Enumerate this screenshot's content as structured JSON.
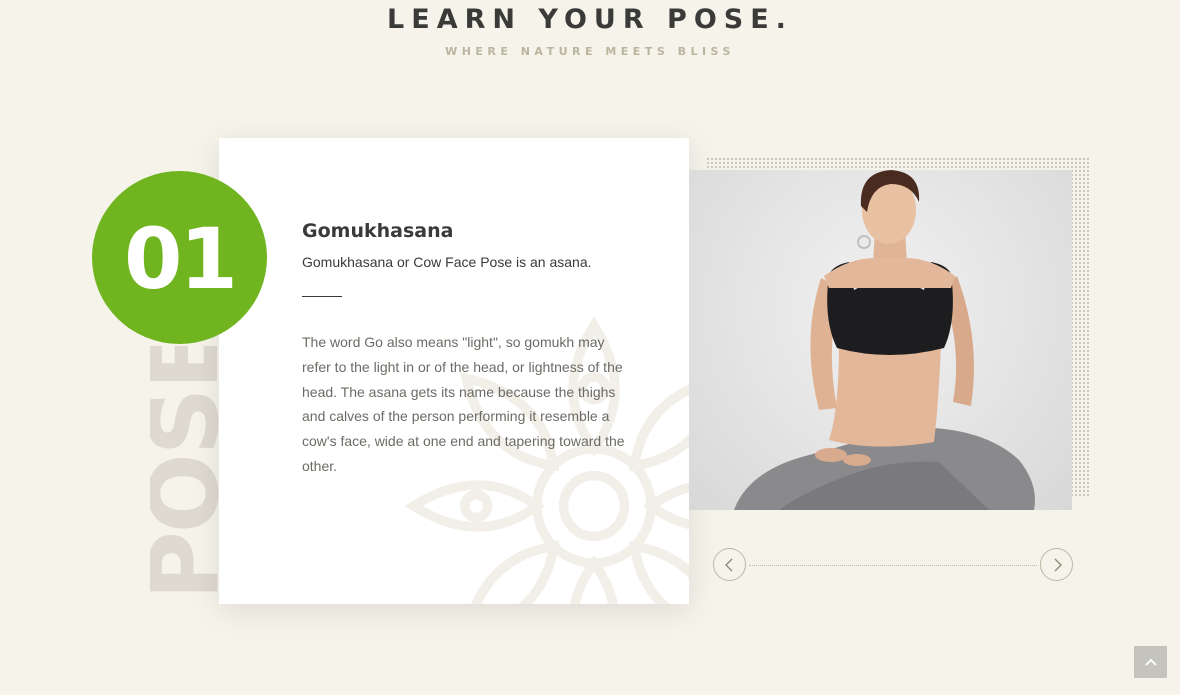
{
  "header": {
    "title": "LEARN YOUR POSE",
    "title_dot": ".",
    "subtitle": "WHERE NATURE MEETS BLISS"
  },
  "vertical_word": "POSE",
  "badge": {
    "number": "01",
    "color": "#70b51f"
  },
  "pose": {
    "title": "Gomukhasana",
    "description": "Gomukhasana or Cow Face Pose is an asana.",
    "body": "The word Go also means \"light\", so gomukh may refer to the light in or of the head, or lightness of the head. The asana gets its name because the thighs and calves of the person performing it resemble a cow's face, wide at one end and tapering toward the other."
  },
  "slider": {
    "prev_icon": "chevron-left-icon",
    "next_icon": "chevron-right-icon"
  },
  "scroll_top_icon": "chevron-up-icon"
}
